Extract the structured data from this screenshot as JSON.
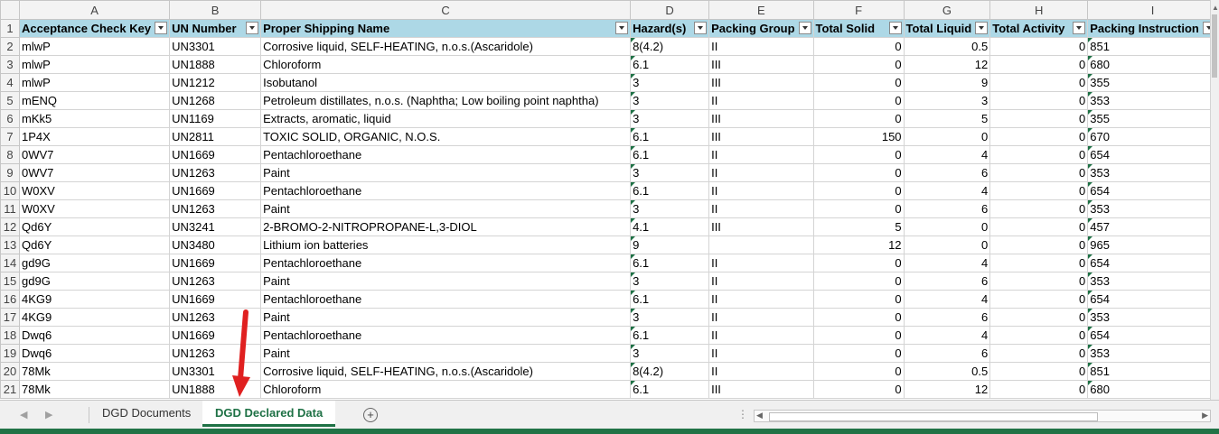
{
  "columns": [
    "A",
    "B",
    "C",
    "D",
    "E",
    "F",
    "G",
    "H",
    "I"
  ],
  "row_numbers": [
    "1",
    "2",
    "3",
    "4",
    "5",
    "6",
    "7",
    "8",
    "9",
    "10",
    "11",
    "12",
    "13",
    "14",
    "15",
    "16",
    "17",
    "18",
    "19",
    "20",
    "21"
  ],
  "headers": [
    "Acceptance Check Key",
    "UN Number",
    "Proper Shipping Name",
    "Hazard(s)",
    "Packing Group",
    "Total Solid",
    "Total Liquid",
    "Total Activity",
    "Packing Instruction"
  ],
  "rows": [
    [
      "mlwP",
      "UN3301",
      "Corrosive liquid, SELF-HEATING, n.o.s.(Ascaridole)",
      "8(4.2)",
      "II",
      "0",
      "0.5",
      "0",
      "851"
    ],
    [
      "mlwP",
      "UN1888",
      "Chloroform",
      "6.1",
      "III",
      "0",
      "12",
      "0",
      "680"
    ],
    [
      "mlwP",
      "UN1212",
      "Isobutanol",
      "3",
      "III",
      "0",
      "9",
      "0",
      "355"
    ],
    [
      "mENQ",
      "UN1268",
      "Petroleum distillates, n.o.s. (Naphtha; Low boiling point naphtha)",
      "3",
      "II",
      "0",
      "3",
      "0",
      "353"
    ],
    [
      "mKk5",
      "UN1169",
      "Extracts, aromatic, liquid",
      "3",
      "III",
      "0",
      "5",
      "0",
      "355"
    ],
    [
      "1P4X",
      "UN2811",
      "TOXIC SOLID, ORGANIC, N.O.S.",
      "6.1",
      "III",
      "150",
      "0",
      "0",
      "670"
    ],
    [
      "0WV7",
      "UN1669",
      "Pentachloroethane",
      "6.1",
      "II",
      "0",
      "4",
      "0",
      "654"
    ],
    [
      "0WV7",
      "UN1263",
      "Paint",
      "3",
      "II",
      "0",
      "6",
      "0",
      "353"
    ],
    [
      "W0XV",
      "UN1669",
      "Pentachloroethane",
      "6.1",
      "II",
      "0",
      "4",
      "0",
      "654"
    ],
    [
      "W0XV",
      "UN1263",
      "Paint",
      "3",
      "II",
      "0",
      "6",
      "0",
      "353"
    ],
    [
      "Qd6Y",
      "UN3241",
      "2-BROMO-2-NITROPROPANE-L,3-DIOL",
      "4.1",
      "III",
      "5",
      "0",
      "0",
      "457"
    ],
    [
      "Qd6Y",
      "UN3480",
      "Lithium ion batteries",
      "9",
      "",
      "12",
      "0",
      "0",
      "965"
    ],
    [
      "gd9G",
      "UN1669",
      "Pentachloroethane",
      "6.1",
      "II",
      "0",
      "4",
      "0",
      "654"
    ],
    [
      "gd9G",
      "UN1263",
      "Paint",
      "3",
      "II",
      "0",
      "6",
      "0",
      "353"
    ],
    [
      "4KG9",
      "UN1669",
      "Pentachloroethane",
      "6.1",
      "II",
      "0",
      "4",
      "0",
      "654"
    ],
    [
      "4KG9",
      "UN1263",
      "Paint",
      "3",
      "II",
      "0",
      "6",
      "0",
      "353"
    ],
    [
      "Dwq6",
      "UN1669",
      "Pentachloroethane",
      "6.1",
      "II",
      "0",
      "4",
      "0",
      "654"
    ],
    [
      "Dwq6",
      "UN1263",
      "Paint",
      "3",
      "II",
      "0",
      "6",
      "0",
      "353"
    ],
    [
      "78Mk",
      "UN3301",
      "Corrosive liquid, SELF-HEATING, n.o.s.(Ascaridole)",
      "8(4.2)",
      "II",
      "0",
      "0.5",
      "0",
      "851"
    ],
    [
      "78Mk",
      "UN1888",
      "Chloroform",
      "6.1",
      "III",
      "0",
      "12",
      "0",
      "680"
    ]
  ],
  "sheet_tabs": [
    {
      "label": "DGD Documents",
      "active": false
    },
    {
      "label": "DGD Declared Data",
      "active": true
    }
  ],
  "colors": {
    "header_fill": "#add8e6",
    "accent": "#217346",
    "arrow": "#e02020"
  }
}
